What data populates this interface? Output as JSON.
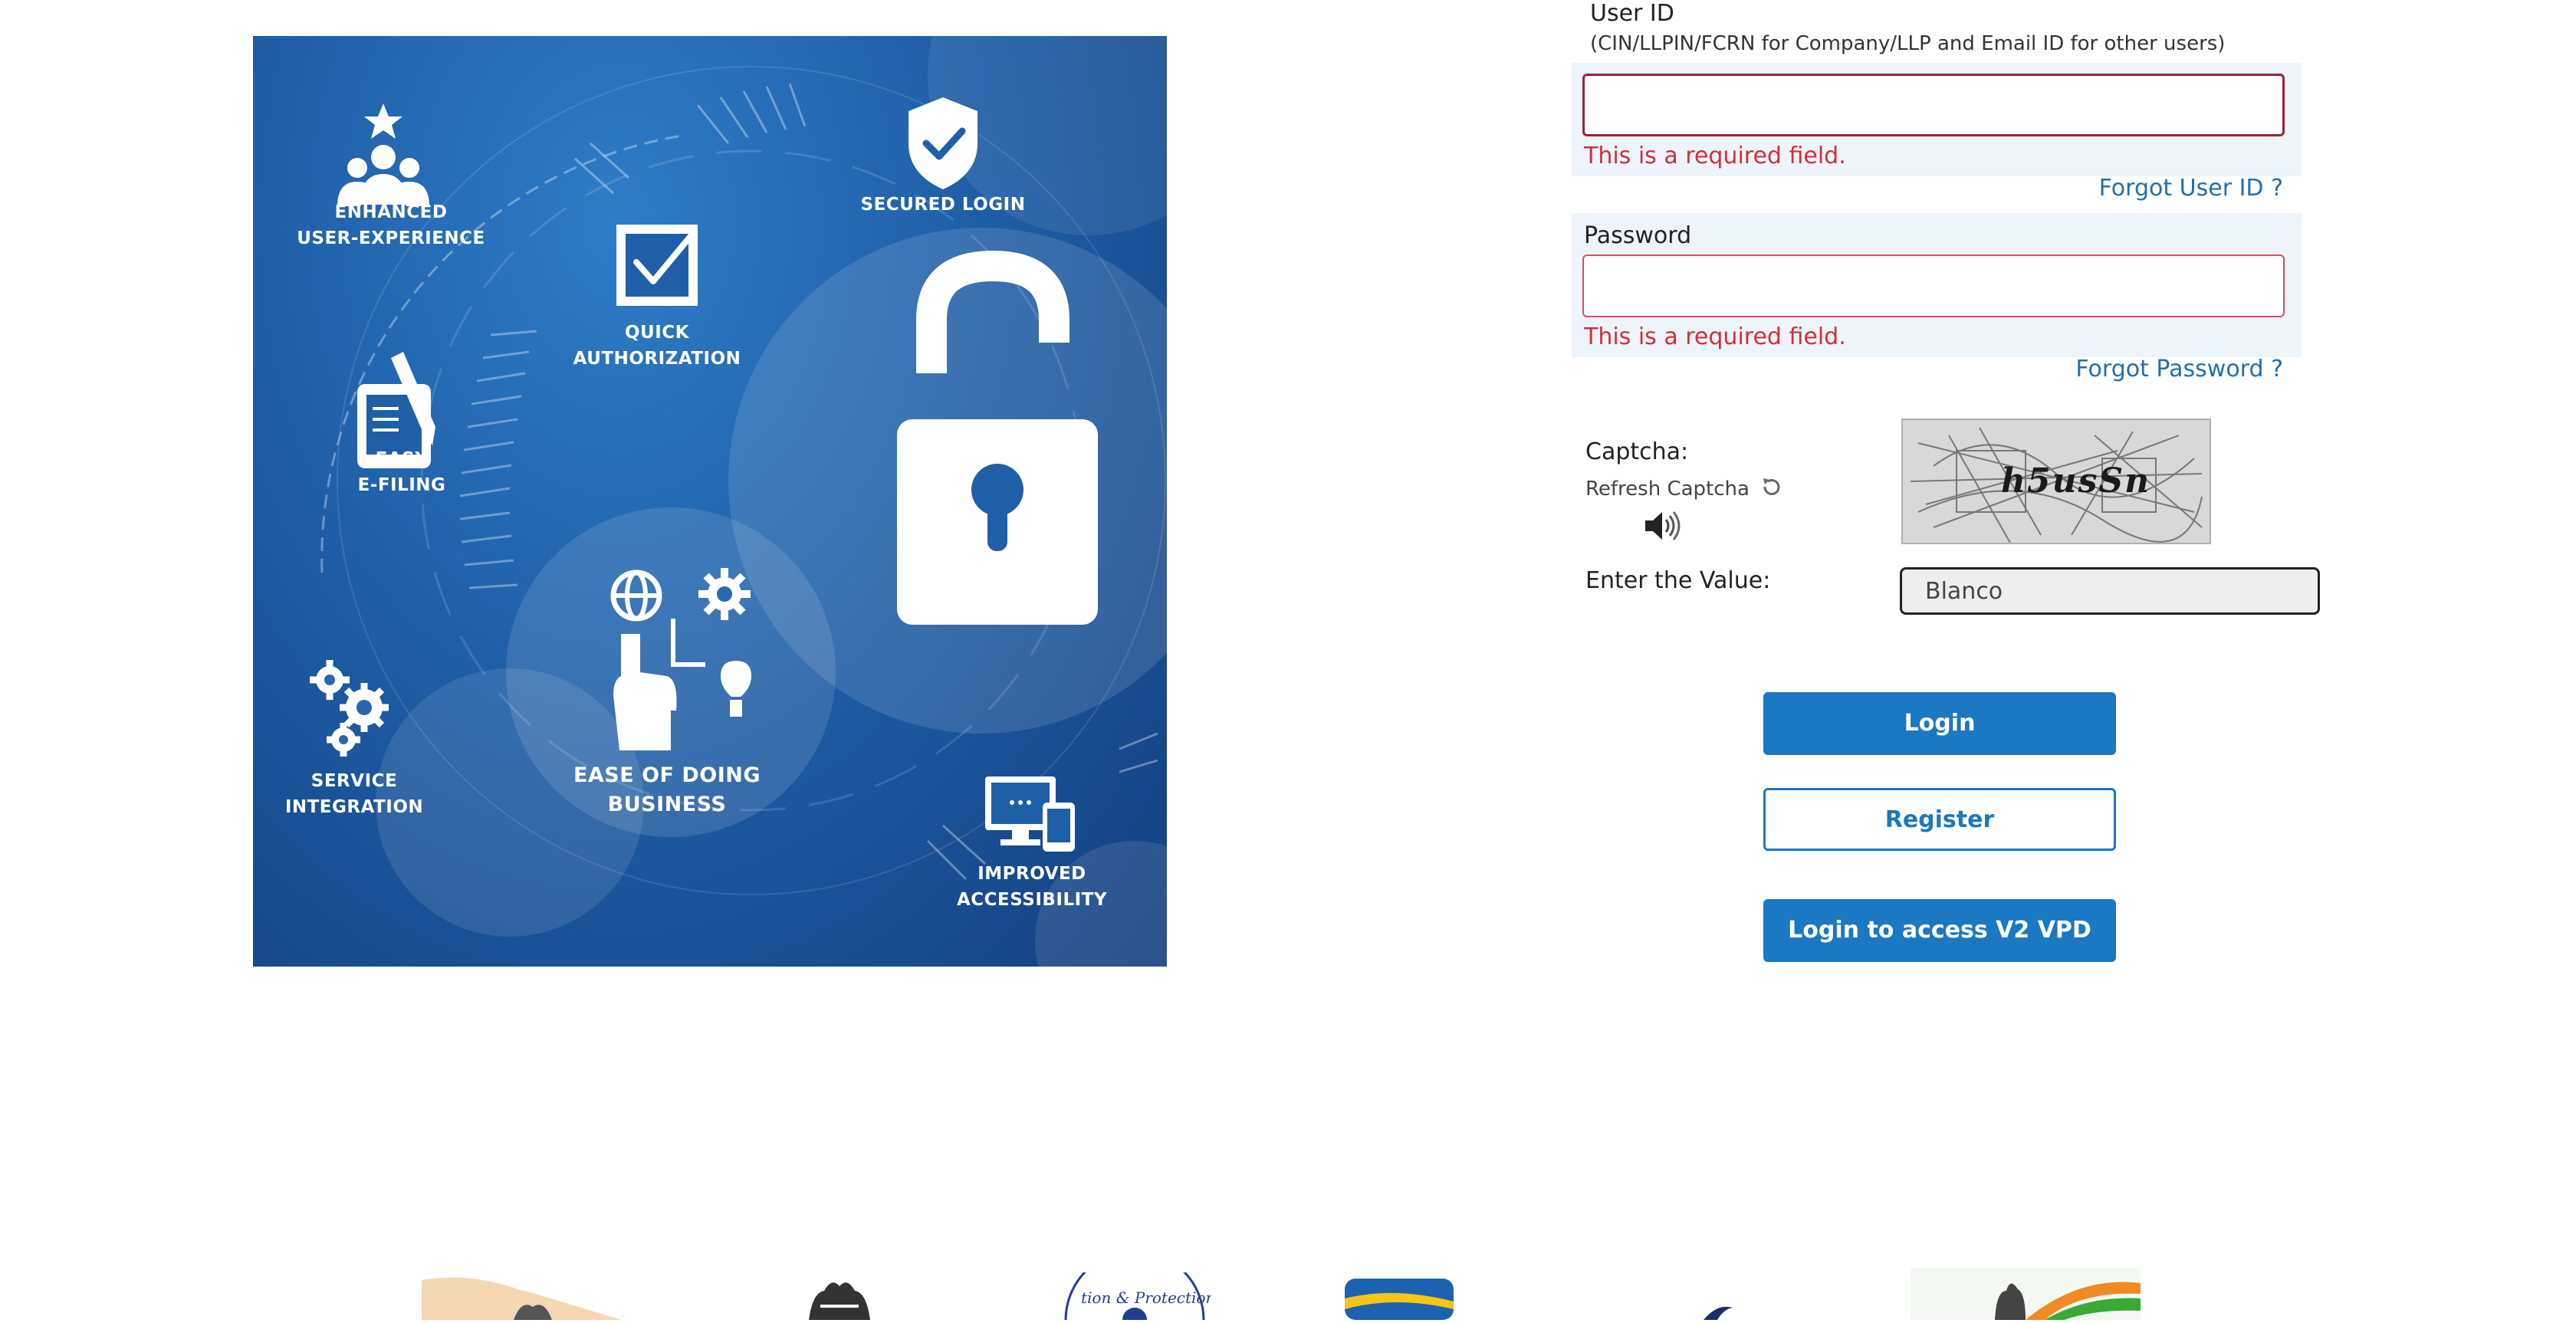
{
  "banner": {
    "features": [
      {
        "id": "enhanced-ux",
        "lines": [
          "ENHANCED",
          "USER-EXPERIENCE"
        ]
      },
      {
        "id": "secured-login",
        "lines": [
          "SECURED LOGIN"
        ]
      },
      {
        "id": "quick-auth",
        "lines": [
          "QUICK",
          "AUTHORIZATION"
        ]
      },
      {
        "id": "easy-efiling",
        "lines": [
          "EASY",
          "E-FILING"
        ]
      },
      {
        "id": "ease-business",
        "lines": [
          "EASE OF DOING",
          "BUSINESS"
        ]
      },
      {
        "id": "service-integration",
        "lines": [
          "SERVICE",
          "INTEGRATION"
        ]
      },
      {
        "id": "improved-access",
        "lines": [
          "IMPROVED",
          "ACCESSIBILITY"
        ]
      }
    ]
  },
  "form": {
    "user_id_label": "User ID",
    "user_id_hint": "(CIN/LLPIN/FCRN for Company/LLP and Email ID for other users)",
    "user_id_value": "",
    "user_id_error": "This is a required field.",
    "forgot_user_id": "Forgot User ID ?",
    "password_label": "Password",
    "password_value": "",
    "password_error": "This is a required field.",
    "forgot_password": "Forgot Password ?",
    "captcha_label": "Captcha:",
    "refresh_captcha": "Refresh Captcha",
    "captcha_text": "h5usSn",
    "enter_value_label": "Enter the Value:",
    "captcha_value": "Blanco",
    "login_button": "Login",
    "register_button": "Register",
    "v2_login_button": "Login to access V2 VPD"
  },
  "icons": {
    "refresh": "refresh-icon",
    "audio": "speaker-icon",
    "lock": "padlock-icon"
  },
  "colors": {
    "primary": "#1b78c2",
    "error": "#d32f3a",
    "link": "#1f6fb2",
    "panel": "#eef4fb"
  }
}
